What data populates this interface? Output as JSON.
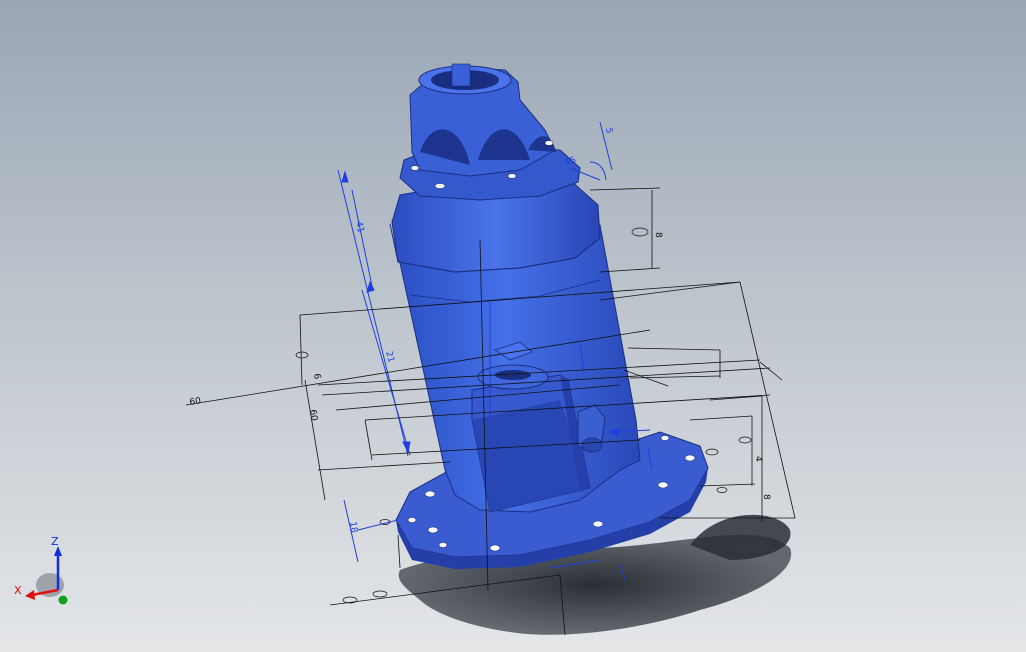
{
  "viewport": {
    "background_top": "#9aa6b5",
    "background_bottom": "#e4e6e8"
  },
  "model": {
    "color": "#3a5fd0",
    "shadow_color": "#2f3540"
  },
  "dimensions": {
    "blue_color": "#1f3fe0",
    "black_color": "#111111",
    "labels": {
      "left_long": "60",
      "d_41": "41",
      "d_21": "21",
      "d_right_top": "8",
      "d_right_mid": "4",
      "d_left_mid": "6",
      "d_left_stack": "60",
      "d_bottom_blue": "18",
      "d_far_right": "8",
      "d_top_small": "5",
      "d_top_angle": "45"
    }
  },
  "triad": {
    "x_label": "X",
    "z_label": "Z",
    "x_color": "#e01010",
    "z_color": "#1030e0",
    "y_color": "#10a020"
  }
}
